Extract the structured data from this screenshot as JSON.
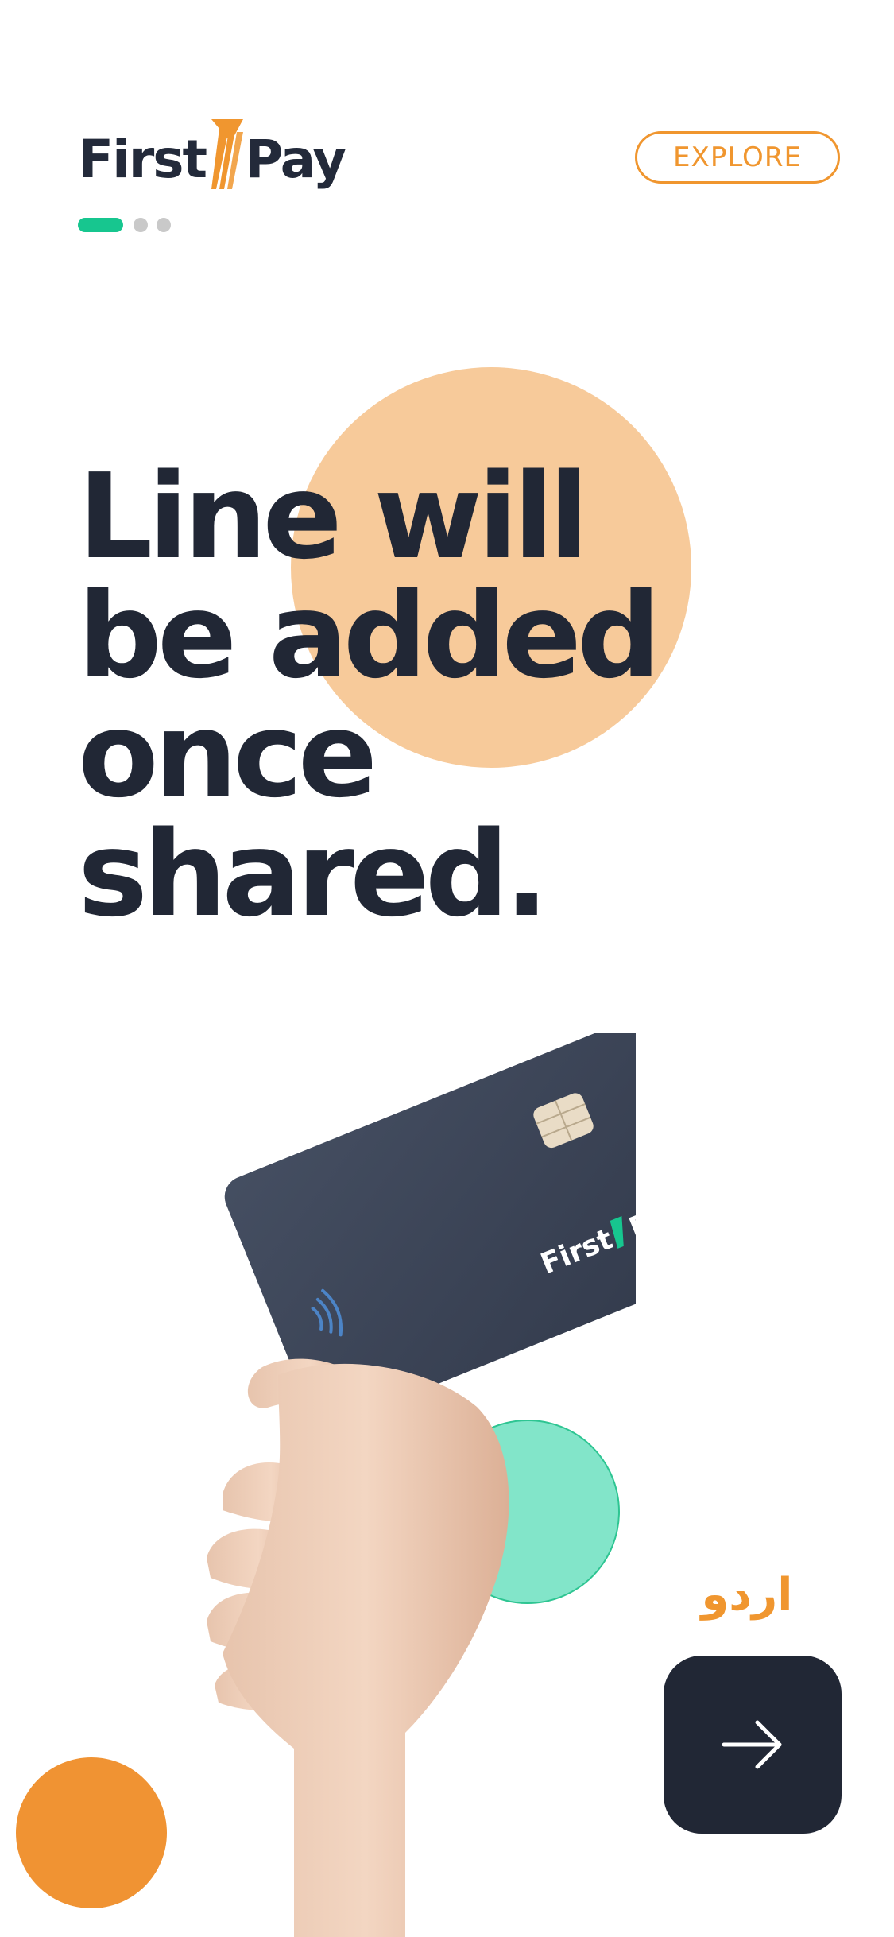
{
  "header": {
    "logo": {
      "first": "First",
      "pay": "Pay",
      "icon": "firstpay-stripes-logo"
    },
    "explore_label": "EXPLORE",
    "pagination": {
      "current": 1,
      "total": 3
    }
  },
  "hero": {
    "headline_lines": [
      "Line will",
      "be added",
      "once",
      "shared."
    ]
  },
  "illustration": {
    "card_brand": "FirstPay",
    "icons": [
      "contactless-icon",
      "card-chip-icon"
    ]
  },
  "footer": {
    "language_label": "اردو",
    "next_icon": "arrow-right-icon"
  },
  "colors": {
    "accent_orange": "#f0962f",
    "accent_green": "#17c68f",
    "peach": "#f7ca9a",
    "mint": "#82e5c9",
    "dark": "#212735",
    "dot_inactive": "#c9c9c9"
  }
}
